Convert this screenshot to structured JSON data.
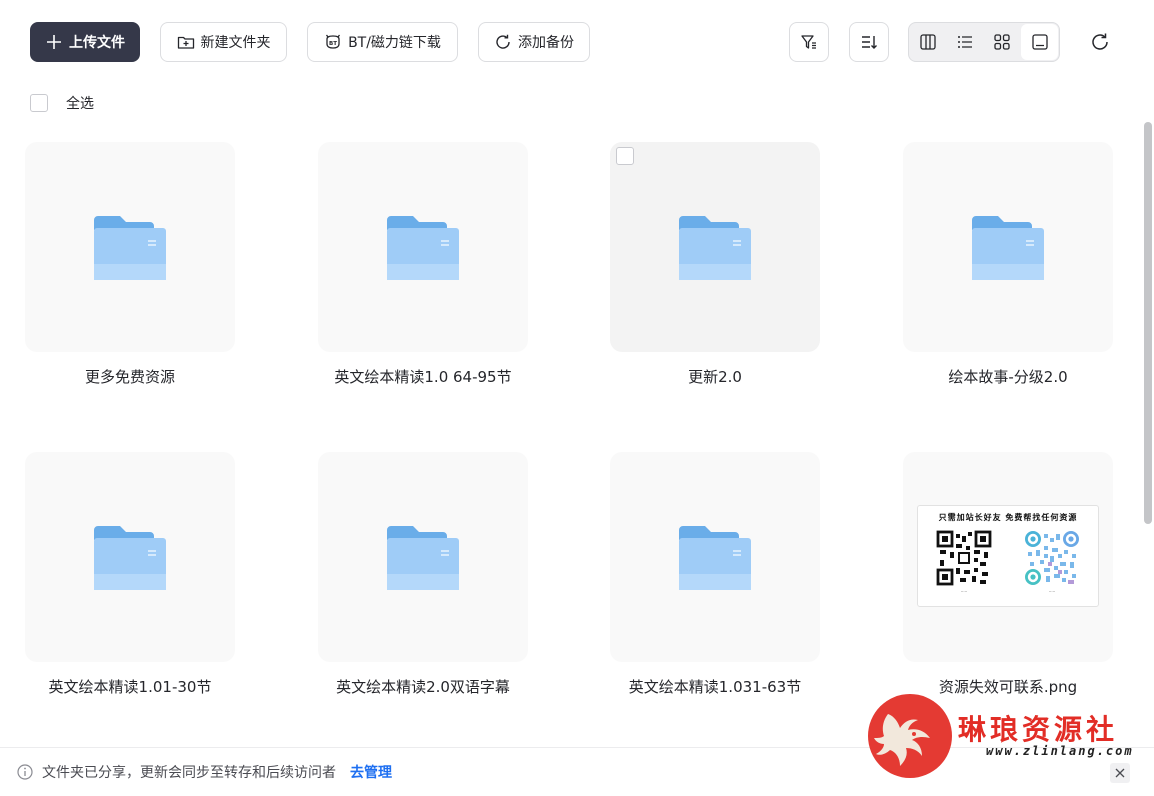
{
  "toolbar": {
    "upload_label": "上传文件",
    "new_folder_label": "新建文件夹",
    "bt_label": "BT/磁力链下载",
    "backup_label": "添加备份"
  },
  "select_all_label": "全选",
  "items": [
    {
      "name": "更多免费资源",
      "type": "folder"
    },
    {
      "name": "英文绘本精读1.0 64-95节",
      "type": "folder"
    },
    {
      "name": "更新2.0",
      "type": "folder"
    },
    {
      "name": "绘本故事-分级2.0",
      "type": "folder"
    },
    {
      "name": "英文绘本精读1.01-30节",
      "type": "folder"
    },
    {
      "name": "英文绘本精读2.0双语字幕",
      "type": "folder"
    },
    {
      "name": "英文绘本精读1.031-63节",
      "type": "folder"
    },
    {
      "name": "资源失效可联系.png",
      "type": "image",
      "thumb_text": "只需加站长好友 免费帮找任何资源"
    }
  ],
  "footer": {
    "message": "文件夹已分享，更新会同步至转存和后续访问者",
    "link": "去管理"
  },
  "watermark": {
    "title": "琳琅资源社",
    "url": "www.zlinlang.com"
  },
  "colors": {
    "primary_button": "#353849",
    "link": "#1e6ff1",
    "folder": "#7cb9f3",
    "watermark": "#e43a33"
  }
}
